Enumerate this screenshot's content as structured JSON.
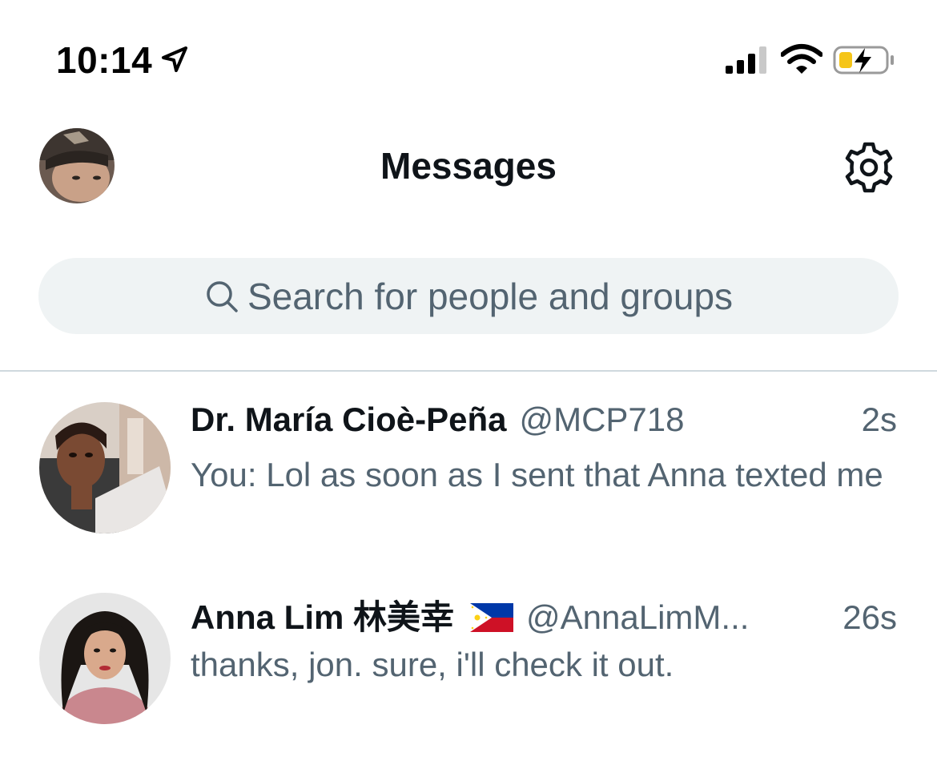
{
  "status_bar": {
    "time": "10:14"
  },
  "header": {
    "title": "Messages"
  },
  "search": {
    "placeholder": "Search for people and groups"
  },
  "conversations": [
    {
      "name": "Dr. María Cioè-Peña",
      "handle": "@MCP718",
      "time": "2s",
      "preview": "You: Lol as soon as I sent that Anna texted me"
    },
    {
      "name": "Anna Lim 林美幸",
      "flag": "philippines-flag",
      "handle": "@AnnaLimM...",
      "time": "26s",
      "preview": "thanks, jon. sure, i'll check it out."
    }
  ],
  "colors": {
    "text_primary": "#0f1419",
    "text_secondary": "#536471",
    "search_bg": "#eff3f4",
    "divider": "#cfd9de",
    "battery_fill": "#f5c518"
  }
}
